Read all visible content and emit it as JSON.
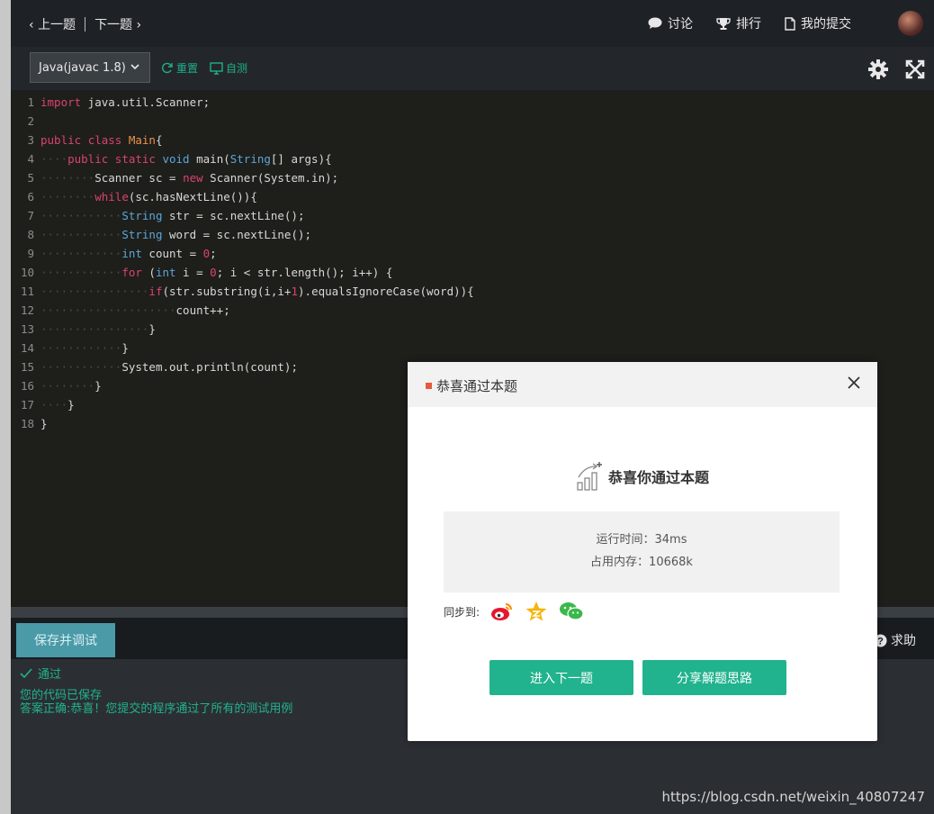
{
  "topbar": {
    "prev": "上一题",
    "next": "下一题",
    "discuss": "讨论",
    "rank": "排行",
    "my_submissions": "我的提交"
  },
  "toolbar": {
    "language": "Java(javac 1.8)",
    "reset": "重置",
    "self_test": "自测"
  },
  "editor": {
    "lines": [
      {
        "n": "1"
      },
      {
        "n": "2"
      },
      {
        "n": "3"
      },
      {
        "n": "4"
      },
      {
        "n": "5"
      },
      {
        "n": "6"
      },
      {
        "n": "7"
      },
      {
        "n": "8"
      },
      {
        "n": "9"
      },
      {
        "n": "10"
      },
      {
        "n": "11"
      },
      {
        "n": "12"
      },
      {
        "n": "13"
      },
      {
        "n": "14"
      },
      {
        "n": "15"
      },
      {
        "n": "16"
      },
      {
        "n": "17"
      },
      {
        "n": "18"
      }
    ]
  },
  "bottom": {
    "save_debug": "保存并调试",
    "help": "求助"
  },
  "result": {
    "status": "通过",
    "saved_msg": "您的代码已保存",
    "correct_msg": "答案正确:恭喜！您提交的程序通过了所有的测试用例"
  },
  "modal": {
    "title": "恭喜通过本题",
    "headline": "恭喜你通过本题",
    "run_time": "运行时间：34ms",
    "memory": "占用内存：10668k",
    "sync_label": "同步到:",
    "next_button": "进入下一题",
    "share_button": "分享解题思路"
  },
  "watermark": "https://blog.csdn.net/weixin_40807247",
  "colors": {
    "accent": "#21b38e",
    "keyword": "#d9446f",
    "type": "#5aa7d8",
    "class_name": "#e8944c"
  }
}
